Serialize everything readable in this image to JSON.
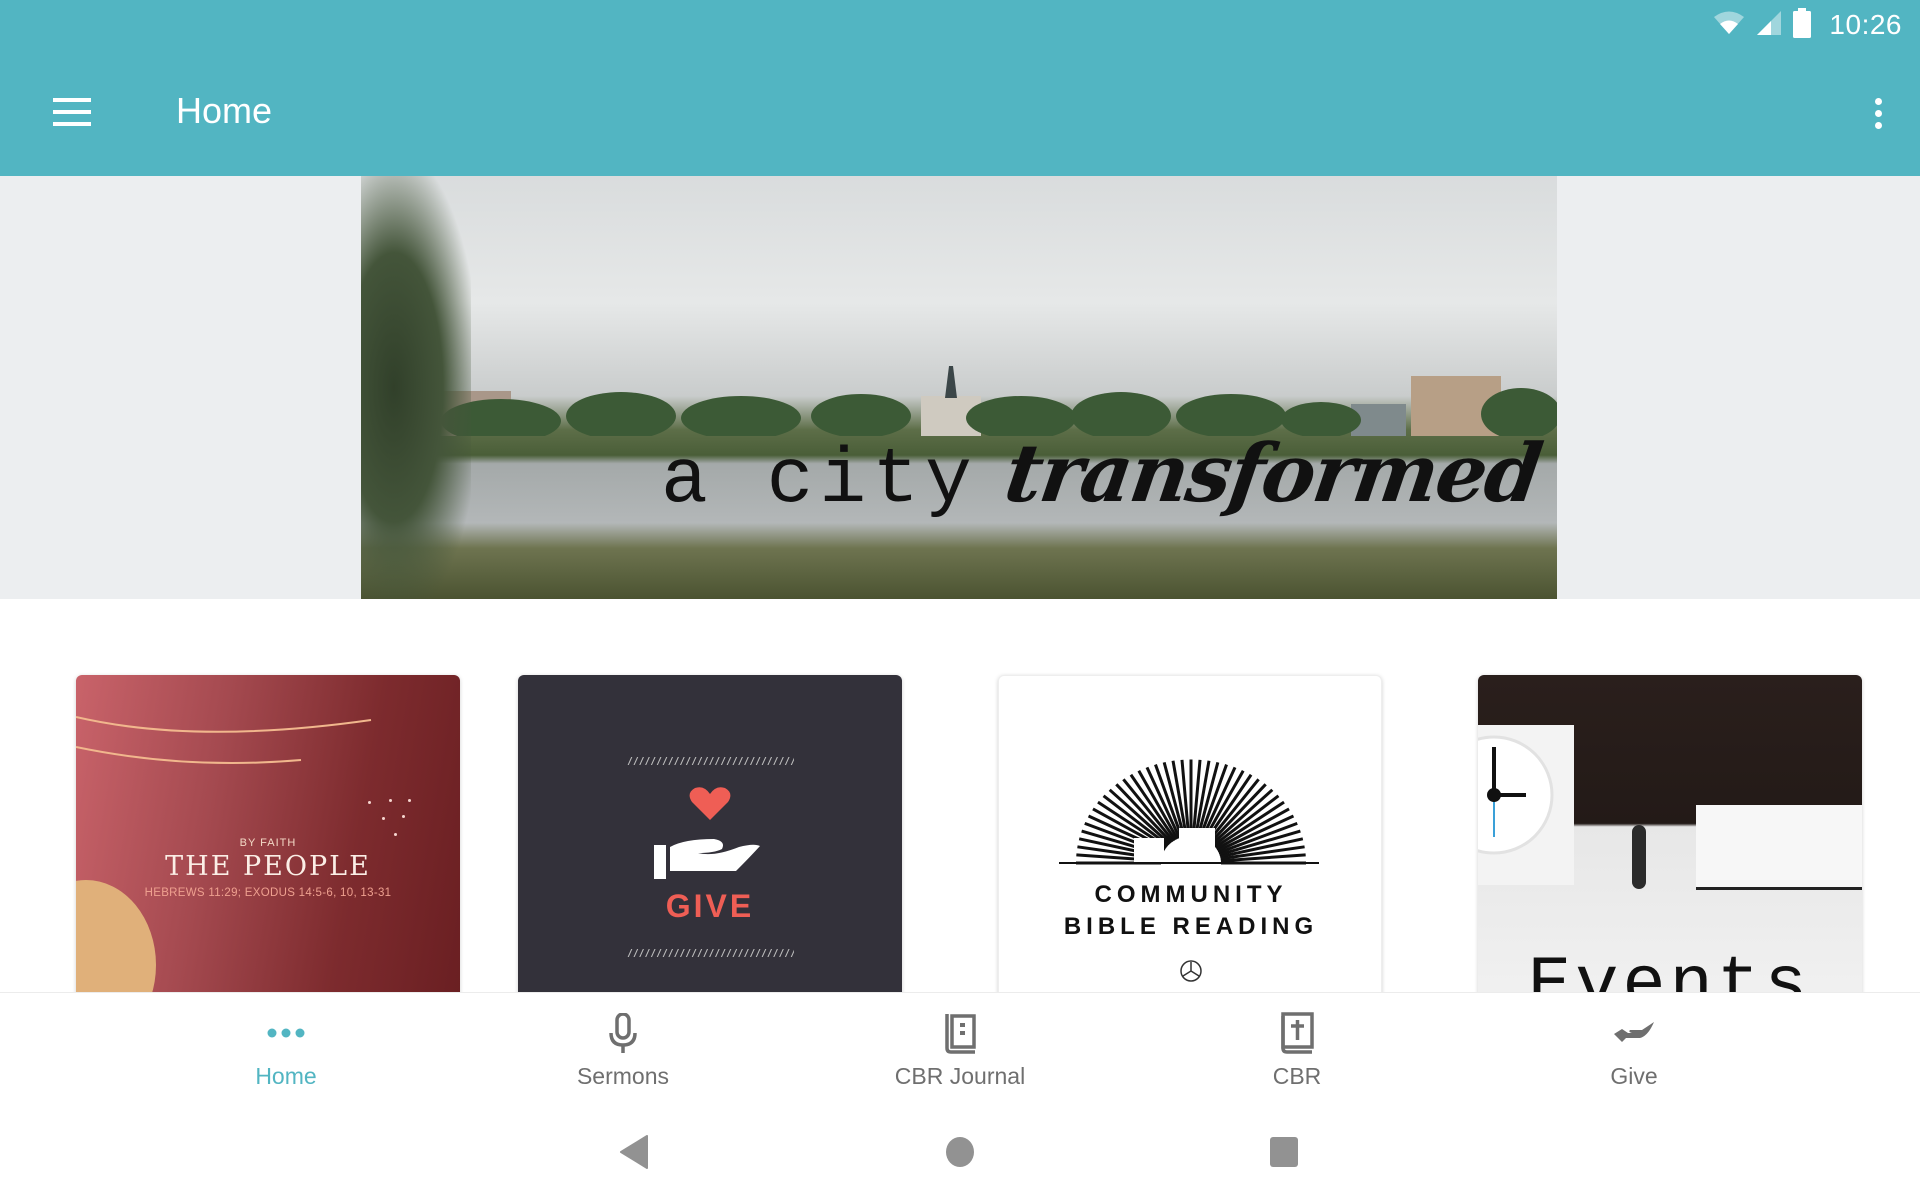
{
  "status_bar": {
    "time": "10:26",
    "icons": [
      "wifi-icon",
      "cell-signal-icon",
      "battery-icon"
    ]
  },
  "app_bar": {
    "title": "Home",
    "menu_icon": "hamburger-menu-icon",
    "overflow_icon": "more-vert-icon"
  },
  "banner": {
    "caption_plain": "a city",
    "caption_script": "transformed"
  },
  "cards": [
    {
      "id": "the-people",
      "kicker": "BY FAITH",
      "title": "THE PEOPLE",
      "reference": "HEBREWS 11:29; EXODUS 14:5-6, 10, 13-31"
    },
    {
      "id": "give",
      "hatch": "//////////////////////////////////////",
      "label": "GIVE"
    },
    {
      "id": "community-bible-reading",
      "line1": "COMMUNITY",
      "line2": "BIBLE READING"
    },
    {
      "id": "events",
      "label": "Events"
    }
  ],
  "bottom_nav": {
    "items": [
      {
        "label": "Home",
        "icon": "more-horiz-icon",
        "active": true
      },
      {
        "label": "Sermons",
        "icon": "microphone-icon",
        "active": false
      },
      {
        "label": "CBR Journal",
        "icon": "journal-icon",
        "active": false
      },
      {
        "label": "CBR",
        "icon": "bible-icon",
        "active": false
      },
      {
        "label": "Give",
        "icon": "giving-hand-icon",
        "active": false
      }
    ]
  },
  "system_nav": {
    "back": "back-icon",
    "home": "home-circle-icon",
    "recents": "recents-square-icon"
  },
  "colors": {
    "primary": "#52b5c2",
    "nav_inactive": "#6f6f6f",
    "give_accent": "#ef5e55",
    "give_card_bg": "#33313a"
  }
}
